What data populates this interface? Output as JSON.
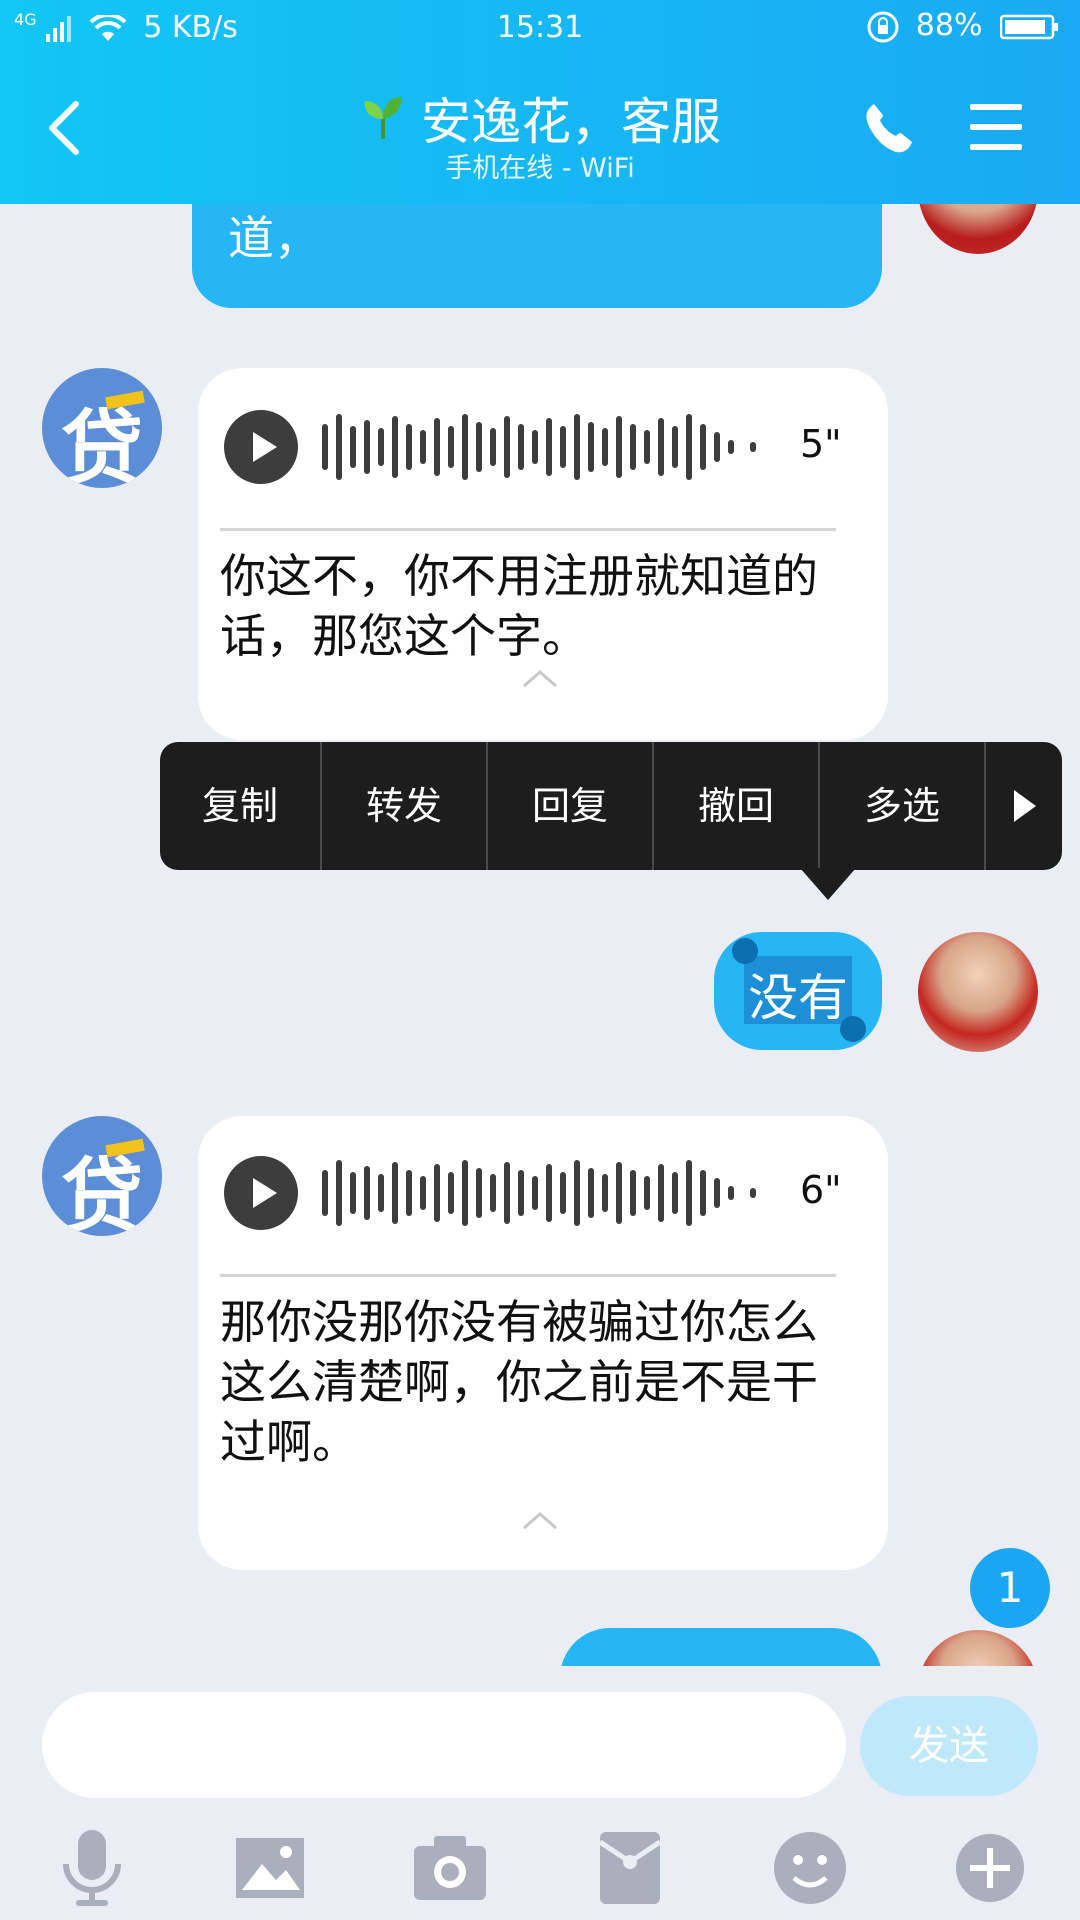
{
  "status_bar": {
    "signal": "4G",
    "speed": "5 KB/s",
    "time": "15:31",
    "battery": "88%"
  },
  "header": {
    "title": "安逸花，客服",
    "subtitle": "手机在线 - WiFi"
  },
  "messages": {
    "partial_sent_text": "道，",
    "voice1": {
      "duration": "5\"",
      "text": "你这不，你不用注册就知道的话，那您这个字。"
    },
    "sent_selected": "没有",
    "voice2": {
      "duration": "6\"",
      "text": "那你没那你没有被骗过你怎么这么清楚啊，你之前是不是干过啊。"
    },
    "unread_badge": "1"
  },
  "context_menu": {
    "copy": "复制",
    "forward": "转发",
    "reply": "回复",
    "recall": "撤回",
    "multi_select": "多选"
  },
  "composer": {
    "placeholder": "",
    "send": "发送"
  },
  "colors": {
    "header_blue": "#1aaaf3",
    "bubble_blue": "#27b6f5",
    "menu_bg": "#1d1d1d"
  }
}
